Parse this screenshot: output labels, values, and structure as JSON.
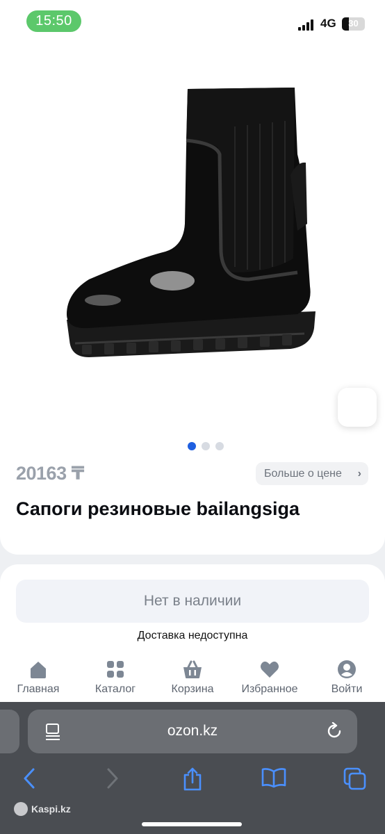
{
  "status_bar": {
    "time": "15:50",
    "network": "4G",
    "battery": "30"
  },
  "product": {
    "price": "20163 ₸",
    "price_more_label": "Больше о цене",
    "title": "Сапоги резиновые bailangsiga",
    "gallery_dots": 3,
    "gallery_active_index": 0,
    "image_icon": "boot-image",
    "search_by_photo_icon": "photo-search-icon"
  },
  "availability": {
    "out_of_stock_label": "Нет в наличии",
    "delivery_text": "Доставка недоступна"
  },
  "tab_bar": {
    "items": [
      {
        "label": "Главная",
        "icon": "home-icon"
      },
      {
        "label": "Каталог",
        "icon": "catalog-icon"
      },
      {
        "label": "Корзина",
        "icon": "basket-icon"
      },
      {
        "label": "Избранное",
        "icon": "heart-icon"
      },
      {
        "label": "Войти",
        "icon": "user-icon"
      }
    ]
  },
  "browser": {
    "url": "ozon.kz",
    "toolbar": [
      "back-icon",
      "forward-icon",
      "share-icon",
      "bookmarks-icon",
      "tabs-icon"
    ],
    "watermark": "Kaspi.kz"
  },
  "colors": {
    "accent_blue": "#1f5fe0",
    "status_green": "#5cc86b",
    "browser_blue": "#4a90ff"
  }
}
